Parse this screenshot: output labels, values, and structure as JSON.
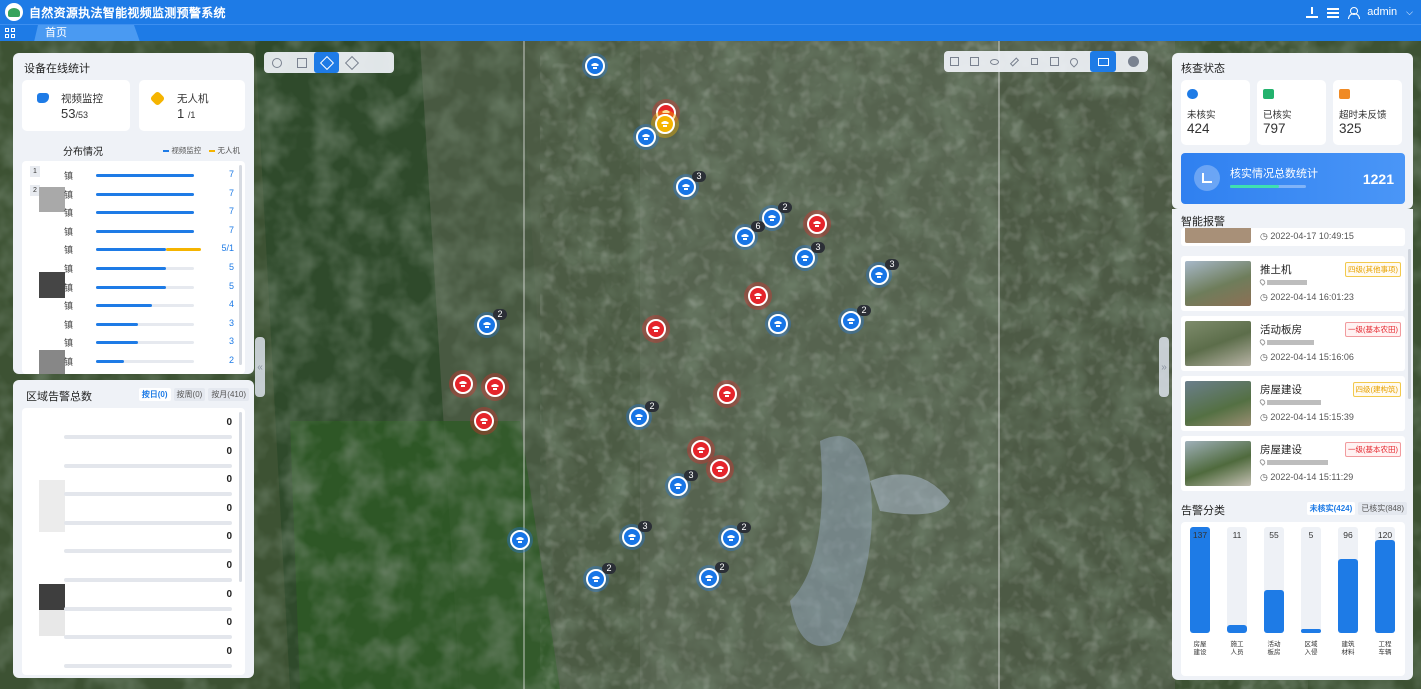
{
  "app": {
    "title": "自然资源执法智能视频监测预警系统",
    "user": "admin"
  },
  "tabs": [
    {
      "label": "首页"
    }
  ],
  "left": {
    "device_title": "设备在线统计",
    "video": {
      "label": "视频监控",
      "value": "53",
      "total": "/53"
    },
    "uav": {
      "label": "无人机",
      "value": "1",
      "total": "/1"
    },
    "dist_title": "分布情况",
    "legend": [
      "视频监控",
      "无人机"
    ],
    "dist_rows": [
      {
        "name": "镇",
        "value": "7",
        "video": 7,
        "uav": 0
      },
      {
        "name": "镇",
        "value": "7",
        "video": 7,
        "uav": 0
      },
      {
        "name": "镇",
        "value": "7",
        "video": 7,
        "uav": 0
      },
      {
        "name": "镇",
        "value": "7",
        "video": 7,
        "uav": 0
      },
      {
        "name": "镇",
        "value": "5/1",
        "video": 5,
        "uav": 1
      },
      {
        "name": "镇",
        "value": "5",
        "video": 5,
        "uav": 0
      },
      {
        "name": "镇",
        "value": "5",
        "video": 5,
        "uav": 0
      },
      {
        "name": "镇",
        "value": "4",
        "video": 4,
        "uav": 0
      },
      {
        "name": "镇",
        "value": "3",
        "video": 3,
        "uav": 0
      },
      {
        "name": "镇",
        "value": "3",
        "video": 3,
        "uav": 0
      },
      {
        "name": "镇",
        "value": "2",
        "video": 2,
        "uav": 0
      }
    ],
    "dist_max": 7,
    "rank_labels": [
      "1",
      "2"
    ],
    "area_title": "区域告警总数",
    "area_filters": [
      "按日(0)",
      "按周(0)",
      "按月(410)"
    ],
    "area_values": [
      "0",
      "0",
      "0",
      "0",
      "0",
      "0",
      "0",
      "0",
      "0"
    ]
  },
  "right": {
    "check_title": "核查状态",
    "check": [
      {
        "label": "未核实",
        "value": "424",
        "color": "#1e7be6"
      },
      {
        "label": "已核实",
        "value": "797",
        "color": "#23b26d"
      },
      {
        "label": "超时未反馈",
        "value": "325",
        "color": "#f08a24"
      }
    ],
    "total": {
      "label": "核实情况总数统计",
      "value": "1221",
      "progress": 0.65
    },
    "alerts_title": "智能报警",
    "alert_top_time": "2022-04-17 10:49:15",
    "alerts": [
      {
        "type": "推土机",
        "tag": "四级(其他事项)",
        "tag_level": "y",
        "time": "2022-04-14 16:01:23"
      },
      {
        "type": "活动板房",
        "tag": "一级(基本农田)",
        "tag_level": "r",
        "time": "2022-04-14 15:16:06"
      },
      {
        "type": "房屋建设",
        "tag": "四级(建构筑)",
        "tag_level": "y",
        "time": "2022-04-14 15:15:39"
      },
      {
        "type": "房屋建设",
        "tag": "一级(基本农田)",
        "tag_level": "r",
        "time": "2022-04-14 15:11:29"
      }
    ],
    "cat_title": "告警分类",
    "cat_filters": [
      "未核实(424)",
      "已核实(848)"
    ],
    "categories": [
      {
        "num": "137",
        "value": 137,
        "label": [
          "房屋",
          "建设"
        ]
      },
      {
        "num": "11",
        "value": 11,
        "label": [
          "施工",
          "人员"
        ]
      },
      {
        "num": "55",
        "value": 55,
        "label": [
          "活动",
          "板房"
        ]
      },
      {
        "num": "5",
        "value": 5,
        "label": [
          "区域",
          "入侵"
        ]
      },
      {
        "num": "96",
        "value": 96,
        "label": [
          "建筑",
          "材料"
        ]
      },
      {
        "num": "120",
        "value": 120,
        "label": [
          "工程",
          "车辆"
        ]
      }
    ],
    "cat_max": 137
  },
  "map": {
    "markers": [
      {
        "k": "b",
        "c": ""
      },
      {
        "k": "r",
        "c": ""
      },
      {
        "k": "y",
        "c": ""
      },
      {
        "k": "b",
        "c": ""
      },
      {
        "k": "b",
        "c": "3"
      },
      {
        "k": "b",
        "c": "2"
      },
      {
        "k": "b",
        "c": "6"
      },
      {
        "k": "r",
        "c": ""
      },
      {
        "k": "b",
        "c": "3"
      },
      {
        "k": "b",
        "c": "3"
      },
      {
        "k": "r",
        "c": ""
      },
      {
        "k": "b",
        "c": "2"
      },
      {
        "k": "b",
        "c": ""
      },
      {
        "k": "r",
        "c": ""
      },
      {
        "k": "b",
        "c": "2"
      },
      {
        "k": "r",
        "c": ""
      },
      {
        "k": "r",
        "c": ""
      },
      {
        "k": "r",
        "c": ""
      },
      {
        "k": "r",
        "c": ""
      },
      {
        "k": "b",
        "c": "2"
      },
      {
        "k": "r",
        "c": ""
      },
      {
        "k": "r",
        "c": ""
      },
      {
        "k": "b",
        "c": "3"
      },
      {
        "k": "b",
        "c": ""
      },
      {
        "k": "b",
        "c": "3"
      },
      {
        "k": "b",
        "c": "2"
      },
      {
        "k": "b",
        "c": "2"
      },
      {
        "k": "b",
        "c": "2"
      }
    ]
  }
}
